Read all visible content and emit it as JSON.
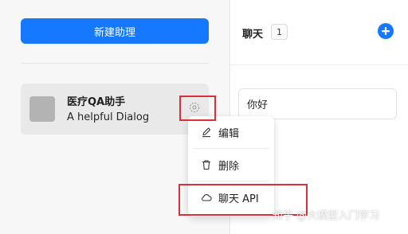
{
  "sidebar": {
    "new_assistant_label": "新建助理",
    "assistants": [
      {
        "name": "医疗QA助手",
        "description": "A helpful Dialog"
      }
    ]
  },
  "menu": {
    "items": [
      {
        "label": "编辑",
        "icon": "edit-icon"
      },
      {
        "label": "删除",
        "icon": "trash-icon"
      },
      {
        "label": "聊天 API",
        "icon": "cloud-icon"
      }
    ]
  },
  "chat": {
    "title": "聊天",
    "count": "1",
    "conversations": [
      {
        "title": "你好"
      }
    ]
  },
  "watermark": "知乎 @大模型入门学习",
  "colors": {
    "primary": "#1677ff",
    "highlight": "#d9303a"
  }
}
